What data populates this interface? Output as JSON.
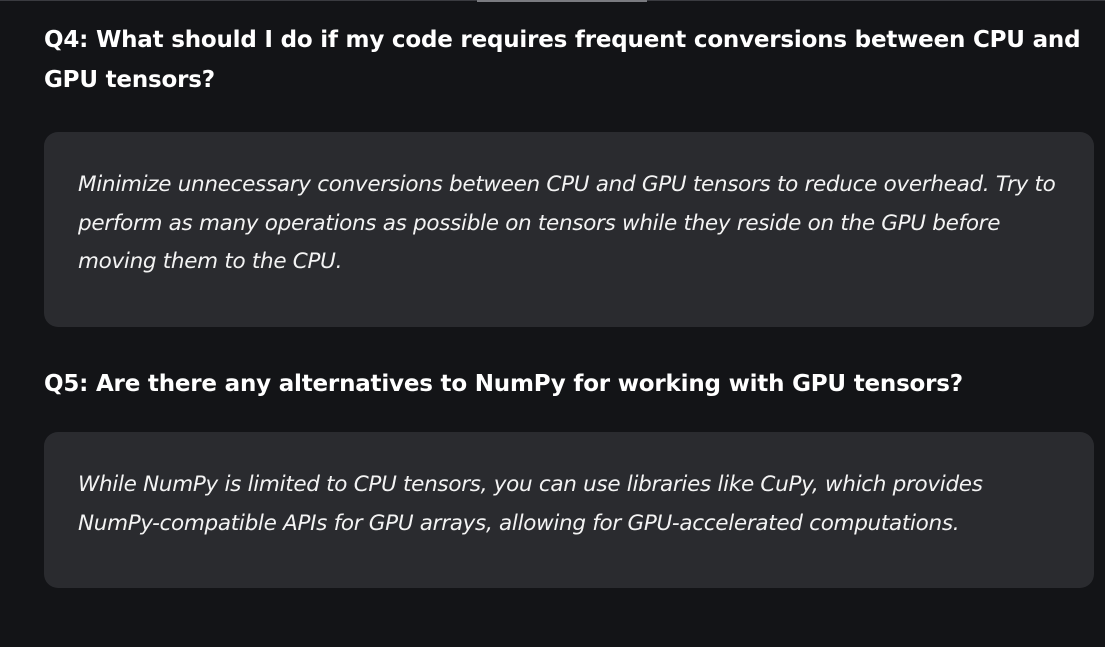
{
  "faqs": [
    {
      "question": "Q4: What should I do if my code requires frequent conversions between CPU and GPU tensors?",
      "answer": "Minimize unnecessary conversions between CPU and GPU tensors to reduce overhead. Try to perform as many operations as possible on tensors while they reside on the GPU before moving them to the CPU."
    },
    {
      "question": "Q5: Are there any alternatives to NumPy for working with GPU tensors?",
      "answer": "While NumPy is limited to CPU tensors, you can use libraries like CuPy, which provides NumPy-compatible APIs for GPU arrays, allowing for GPU-accelerated computations."
    }
  ],
  "colors": {
    "background": "#131417",
    "answer_box": "#2a2b2f",
    "text": "#ffffff"
  }
}
